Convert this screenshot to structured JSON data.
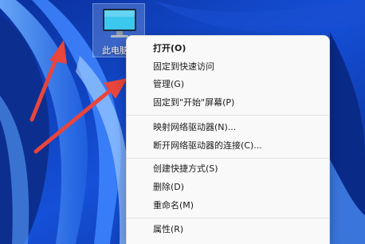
{
  "desktop": {
    "icon_label": "此电脑",
    "icon_name": "monitor-icon"
  },
  "context_menu": {
    "items": [
      {
        "label": "打开(O)",
        "bold": true
      },
      {
        "label": "固定到快速访问"
      },
      {
        "label": "管理(G)"
      },
      {
        "label": "固定到\"开始\"屏幕(P)"
      },
      {
        "label": "映射网络驱动器(N)..."
      },
      {
        "label": "断开网络驱动器的连接(C)..."
      },
      {
        "label": "创建快捷方式(S)"
      },
      {
        "label": "删除(D)"
      },
      {
        "label": "重命名(M)"
      },
      {
        "label": "属性(R)"
      }
    ]
  },
  "colors": {
    "annotation_arrow": "#e8453c",
    "menu_background": "#f9f9f9",
    "wallpaper_accent": "#2a6cf0"
  }
}
